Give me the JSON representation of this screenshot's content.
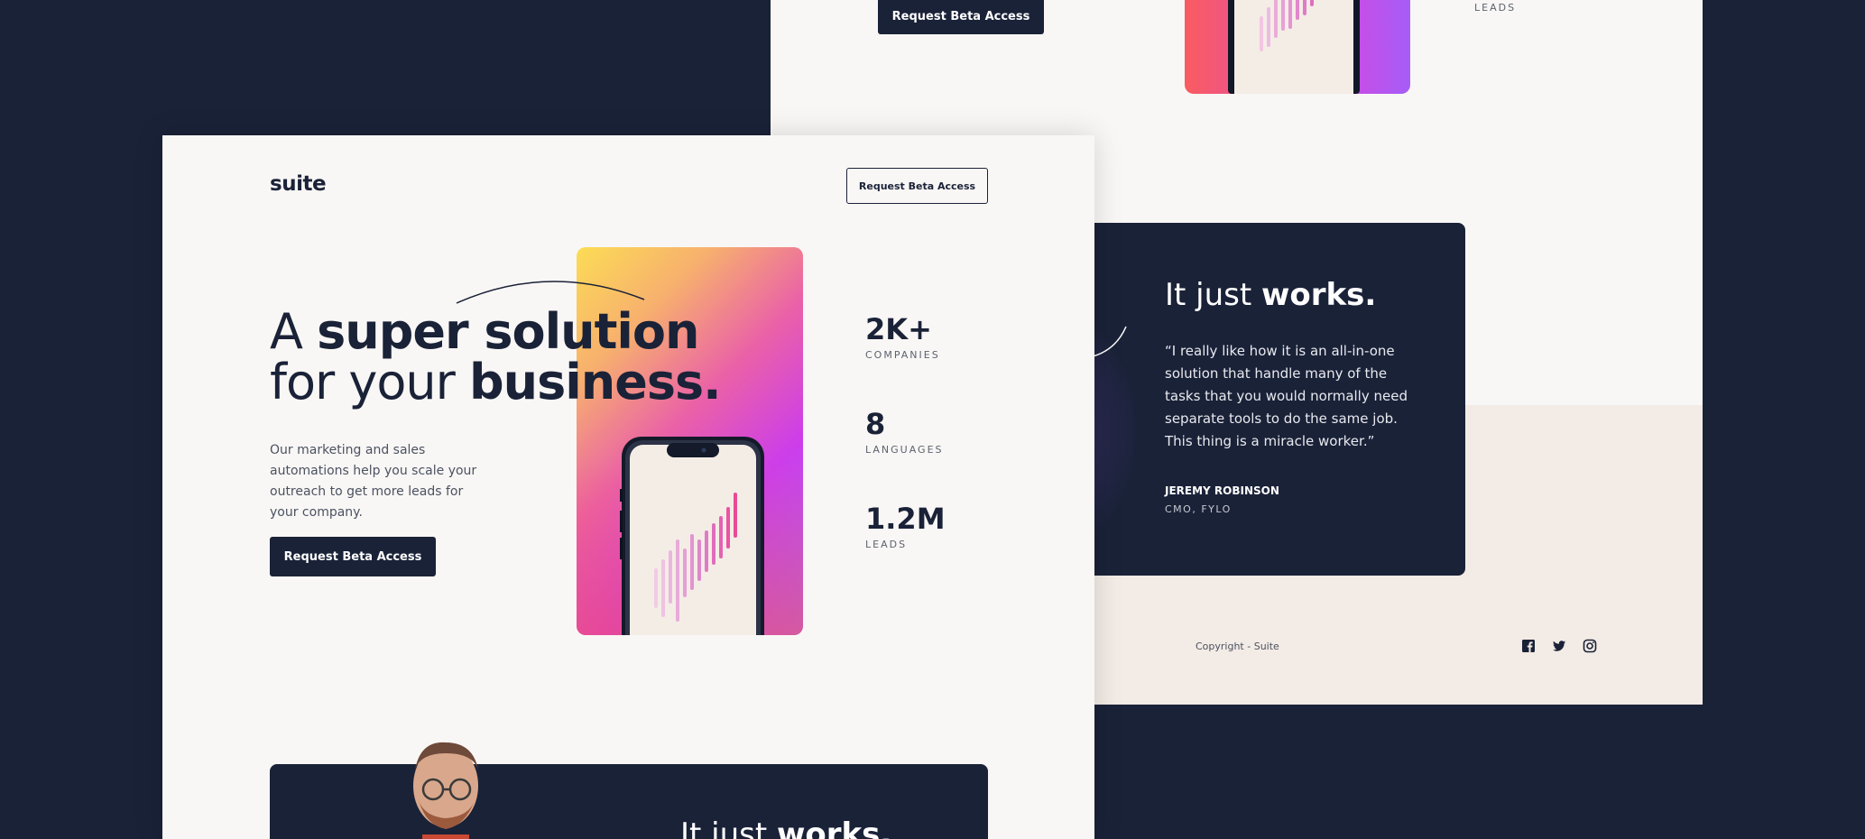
{
  "brand": {
    "logo": "suite"
  },
  "header": {
    "cta": "Request Beta Access"
  },
  "hero": {
    "title_line1_light": "A ",
    "title_line1_bold": "super solution",
    "title_line2_light": "for your ",
    "title_line2_bold": "business.",
    "description": "Our marketing and sales automations help you scale your outreach to get more leads for your company.",
    "cta": "Request Beta Access"
  },
  "stats": [
    {
      "value": "2K+",
      "label": "COMPANIES"
    },
    {
      "value": "8",
      "label": "LANGUAGES"
    },
    {
      "value": "1.2M",
      "label": "LEADS"
    }
  ],
  "back_page": {
    "cta": "Request Beta Access",
    "stat_label": "LEADS"
  },
  "testimonial": {
    "title_light": "It just ",
    "title_bold": "works.",
    "quote": "“I really like how it is an all-in-one solution that handle many of the tasks that you would normally need separate tools to do the same job. This thing is a miracle worker.”",
    "name": "JEREMY ROBINSON",
    "role": "CMO, FYLO"
  },
  "footer": {
    "copyright": "Copyright - Suite",
    "socials": [
      "facebook-icon",
      "twitter-icon",
      "instagram-icon"
    ]
  },
  "colors": {
    "navy": "#1a2238",
    "cream": "#f9f7f5",
    "beige": "#f3ebe5"
  }
}
